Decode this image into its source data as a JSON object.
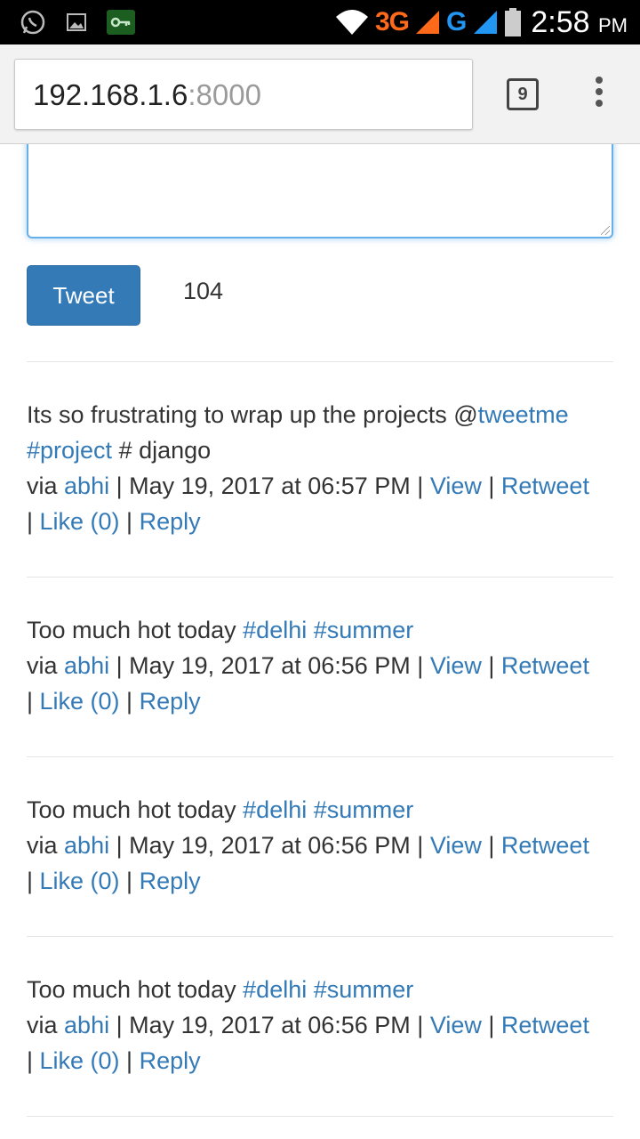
{
  "status_bar": {
    "network_3g": "3G",
    "network_g": "G",
    "time": "2:58",
    "ampm": "PM",
    "icons": [
      "whatsapp-icon",
      "gallery-icon",
      "vpn-key-icon",
      "wifi-icon",
      "signal-icon",
      "battery-icon"
    ]
  },
  "browser": {
    "url_host": "192.168.1.6",
    "url_port": ":8000",
    "tab_count": "9"
  },
  "composer": {
    "tweet_button": "Tweet",
    "char_count": "104"
  },
  "colors": {
    "link": "#337ab7",
    "button": "#337ab7",
    "text": "#333333"
  },
  "tweets": [
    {
      "text": "Its so frustrating to wrap up the projects @",
      "mention": "tweetme",
      "hashtag1": "#project",
      "rest": " # django",
      "via": "via ",
      "user": "abhi",
      "date": " | May 19, 2017 at 06:57 PM | ",
      "view": "View",
      "sep": " | ",
      "retweet": "Retweet",
      "sep_start": "| ",
      "like": "Like (0)",
      "sep2": " | ",
      "reply": "Reply"
    },
    {
      "text": "Too much hot today ",
      "hashtag1": "#delhi",
      "hashtag2": "#summer",
      "via": "via ",
      "user": "abhi",
      "date": " | May 19, 2017 at 06:56 PM | ",
      "view": "View",
      "sep": " | ",
      "retweet": "Retweet",
      "sep_start": "| ",
      "like": "Like (0)",
      "sep2": " | ",
      "reply": "Reply"
    },
    {
      "text": "Too much hot today ",
      "hashtag1": "#delhi",
      "hashtag2": "#summer",
      "via": "via ",
      "user": "abhi",
      "date": " | May 19, 2017 at 06:56 PM | ",
      "view": "View",
      "sep": " | ",
      "retweet": "Retweet",
      "sep_start": "| ",
      "like": "Like (0)",
      "sep2": " | ",
      "reply": "Reply"
    },
    {
      "text": "Too much hot today ",
      "hashtag1": "#delhi",
      "hashtag2": "#summer",
      "via": "via ",
      "user": "abhi",
      "date": " | May 19, 2017 at 06:56 PM | ",
      "view": "View",
      "sep": " | ",
      "retweet": "Retweet",
      "sep_start": "| ",
      "like": "Like (0)",
      "sep2": " | ",
      "reply": "Reply"
    }
  ]
}
